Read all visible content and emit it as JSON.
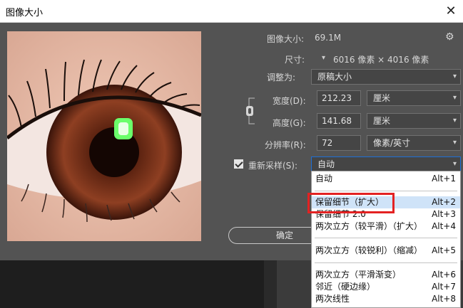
{
  "window": {
    "title": "图像大小",
    "close_icon": "close-icon"
  },
  "info": {
    "size_label": "图像大小:",
    "size_value": "69.1M",
    "dimensions_label": "尺寸:",
    "dimensions_value": "6016 像素 × 4016 像素"
  },
  "adjust": {
    "label": "调整为:",
    "value": "原稿大小"
  },
  "width": {
    "label": "宽度(D):",
    "value": "212.23",
    "unit": "厘米"
  },
  "height": {
    "label": "高度(G):",
    "value": "141.68",
    "unit": "厘米"
  },
  "resolution": {
    "label": "分辨率(R):",
    "value": "72",
    "unit": "像素/英寸"
  },
  "resample": {
    "label": "重新采样(S):",
    "value": "自动",
    "checked": true
  },
  "buttons": {
    "ok": "确定"
  },
  "dropdown": {
    "items": [
      {
        "label": "自动",
        "shortcut": "Alt+1"
      },
      {
        "label": "保留细节（扩大）",
        "shortcut": "Alt+2"
      },
      {
        "label": "保留细节 2.0",
        "shortcut": "Alt+3"
      },
      {
        "label": "两次立方（较平滑）（扩大）",
        "shortcut": "Alt+4"
      },
      {
        "label": "两次立方（较锐利）（缩减）",
        "shortcut": "Alt+5"
      },
      {
        "label": "两次立方（平滑渐变）",
        "shortcut": "Alt+6"
      },
      {
        "label": "邻近（硬边缘）",
        "shortcut": "Alt+7"
      },
      {
        "label": "两次线性",
        "shortcut": "Alt+8"
      }
    ]
  },
  "colors": {
    "highlight": "#cfe3f8",
    "callout": "#e32222",
    "panel": "#535353"
  }
}
